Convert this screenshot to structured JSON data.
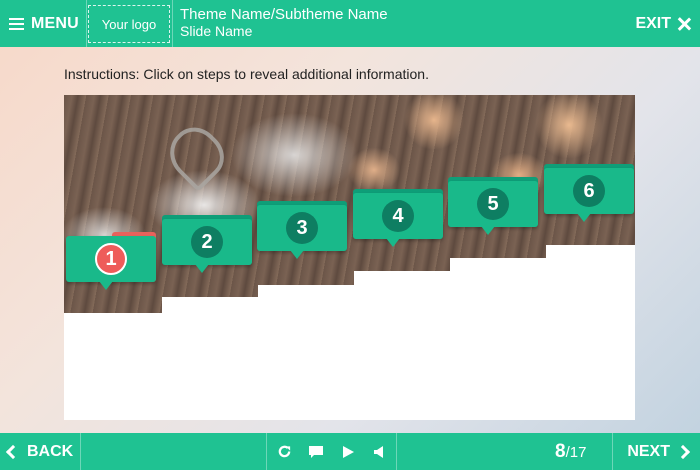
{
  "header": {
    "menu_label": "MENU",
    "logo_text": "Your logo",
    "theme_title": "Theme Name/Subtheme Name",
    "slide_name": "Slide Name",
    "exit_label": "EXIT"
  },
  "instructions": "Instructions: Click on steps to reveal additional information.",
  "steps": [
    {
      "number": "1",
      "active": true
    },
    {
      "number": "2",
      "active": false
    },
    {
      "number": "3",
      "active": false
    },
    {
      "number": "4",
      "active": false
    },
    {
      "number": "5",
      "active": false
    },
    {
      "number": "6",
      "active": false
    }
  ],
  "footer": {
    "back_label": "BACK",
    "next_label": "NEXT",
    "current_page": "8",
    "total_pages": "/17",
    "controls": [
      "reload-icon",
      "comment-icon",
      "play-icon",
      "volume-icon"
    ]
  },
  "colors": {
    "accent": "#1fc292",
    "step_fill": "#19b98a",
    "step_number_bg": "#0e7e62",
    "active_step": "#ee5c5a"
  }
}
